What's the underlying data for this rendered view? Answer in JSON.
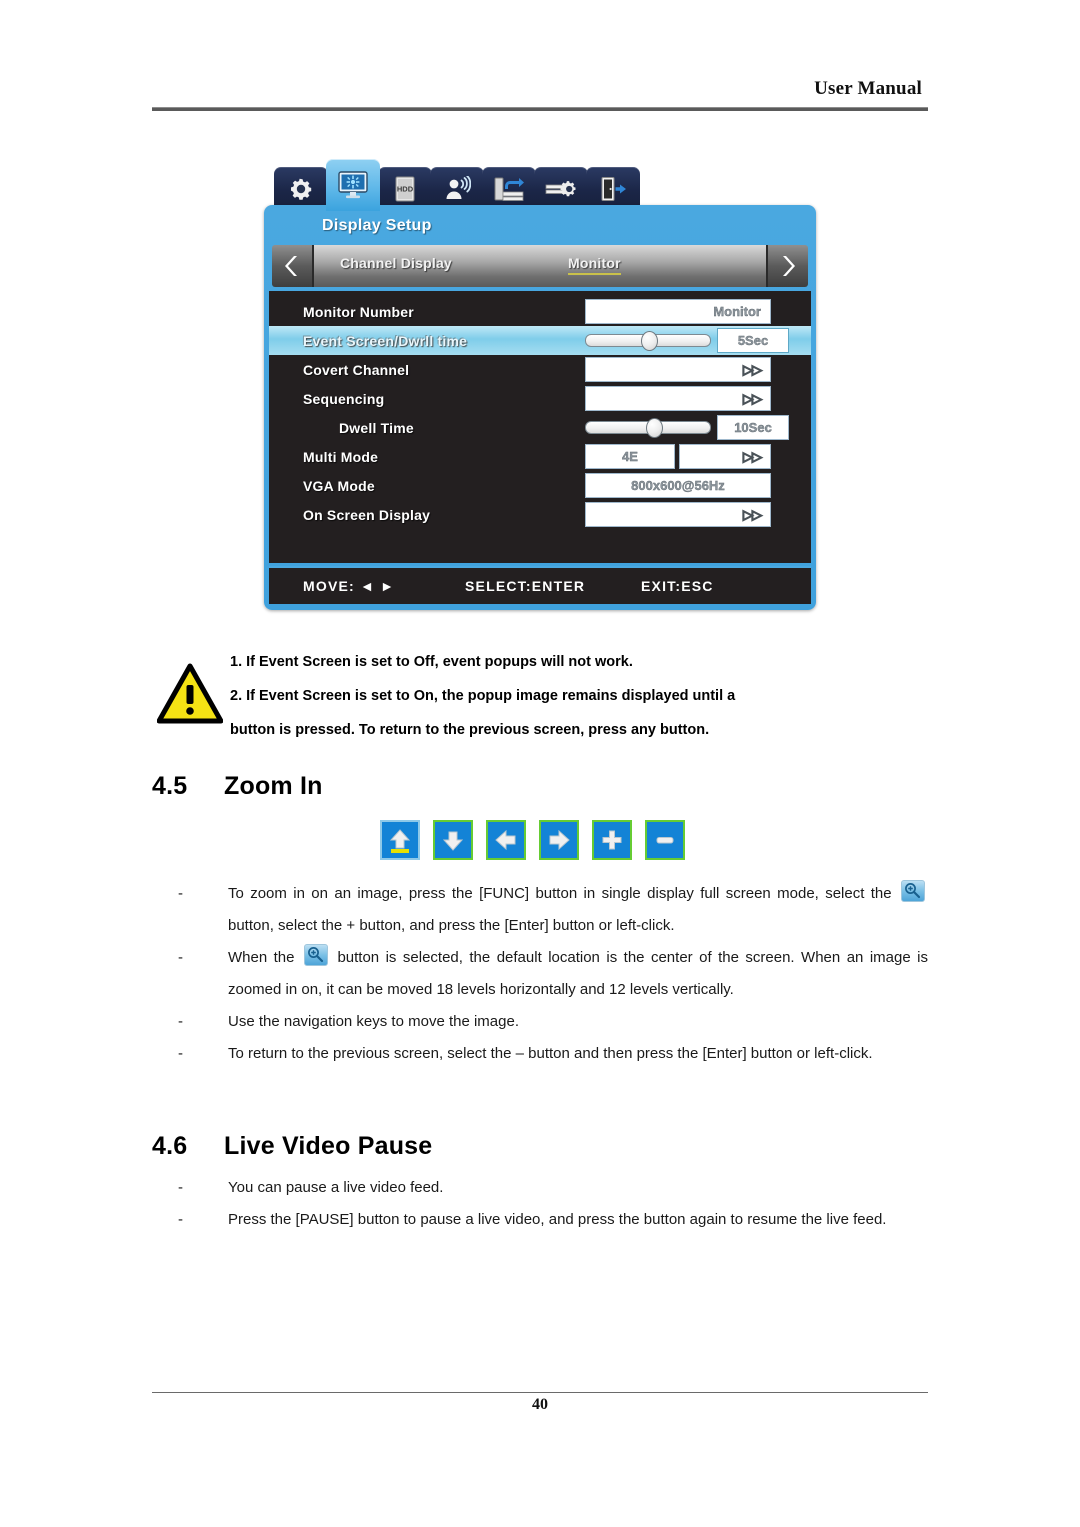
{
  "header": {
    "title": "User Manual"
  },
  "osd": {
    "tabs": [
      {
        "name": "system-setup-tab",
        "icon": "gear-icon",
        "selected": false
      },
      {
        "name": "display-setup-tab",
        "icon": "monitor-icon",
        "selected": true
      },
      {
        "name": "hdd-setup-tab",
        "icon": "hdd-icon",
        "selected": false
      },
      {
        "name": "user-setup-tab",
        "icon": "user-audio-icon",
        "selected": false
      },
      {
        "name": "backup-setup-tab",
        "icon": "device-import-icon",
        "selected": false
      },
      {
        "name": "device-config-tab",
        "icon": "device-gear-icon",
        "selected": false
      },
      {
        "name": "exit-tab",
        "icon": "exit-door-icon",
        "selected": false
      }
    ],
    "title": "Display Setup",
    "nav": {
      "prev_icon": "chevron-left-icon",
      "next_icon": "chevron-right-icon",
      "items": [
        {
          "label": "Channel Display",
          "active": false
        },
        {
          "label": "Monitor",
          "active": true
        }
      ]
    },
    "rows": [
      {
        "label": "Monitor Number",
        "type": "value",
        "value": "Monitor",
        "indent": false,
        "highlight": false
      },
      {
        "label": "Event Screen/Dwrll time",
        "type": "slider-value",
        "value": "5Sec",
        "indent": false,
        "highlight": true,
        "slider_pct": 44
      },
      {
        "label": "Covert Channel",
        "type": "chevron",
        "value": "▷▷",
        "indent": false,
        "highlight": false
      },
      {
        "label": "Sequencing",
        "type": "chevron",
        "value": "▷▷",
        "indent": false,
        "highlight": false
      },
      {
        "label": "Dwell Time",
        "type": "slider-value",
        "value": "10Sec",
        "indent": true,
        "highlight": false,
        "slider_pct": 48
      },
      {
        "label": "Multi Mode",
        "type": "dual",
        "value": "4E",
        "value2": "▷▷",
        "indent": false,
        "highlight": false
      },
      {
        "label": "VGA Mode",
        "type": "value",
        "value": "800x600@56Hz",
        "indent": false,
        "highlight": false
      },
      {
        "label": "On Screen Display",
        "type": "chevron",
        "value": "▷▷",
        "indent": false,
        "highlight": false
      }
    ],
    "footer": {
      "move": "MOVE: ◄ ►",
      "select": "SELECT:ENTER",
      "exit": "EXIT:ESC"
    }
  },
  "note": {
    "icon": "warning-triangle-icon",
    "line1": "1. If Event Screen is set to Off, event popups will not work.",
    "line2": "2. If Event Screen is set to On, the popup image remains displayed until a",
    "line3": "button is pressed. To return to the previous screen, press any button."
  },
  "sections": {
    "zoom_in": {
      "number": "4.5",
      "title": "Zoom In",
      "buttons": [
        {
          "name": "zoom-up-button",
          "icon": "arrow-up-icon",
          "selected": true
        },
        {
          "name": "zoom-down-button",
          "icon": "arrow-down-icon",
          "selected": false
        },
        {
          "name": "zoom-left-button",
          "icon": "arrow-left-icon",
          "selected": false
        },
        {
          "name": "zoom-right-button",
          "icon": "arrow-right-icon",
          "selected": false
        },
        {
          "name": "zoom-in-button",
          "icon": "plus-icon",
          "selected": false
        },
        {
          "name": "zoom-out-button",
          "icon": "minus-icon",
          "selected": false
        }
      ],
      "bullets": [
        {
          "dash": "-",
          "part1": "To zoom in on an image, press the [FUNC] button in single display full screen mode, select the",
          "icon": "magnifier-plus-icon",
          "part2": "button, select the + button, and press the [Enter] button or left-click."
        },
        {
          "dash": "-",
          "part1": "When the",
          "icon": "magnifier-plus-icon",
          "part2": "button is selected, the default location is the center of the screen. When an image is zoomed in on, it can be moved 18 levels horizontally and 12 levels vertically."
        },
        {
          "dash": "-",
          "text": "Use the navigation keys to move the image."
        },
        {
          "dash": "-",
          "text": "To return to the previous screen, select the – button and then press the [Enter] button or left-click."
        }
      ]
    },
    "live_video_pause": {
      "number": "4.6",
      "title": "Live Video Pause",
      "bullets": [
        {
          "dash": "-",
          "text": "You can pause a live video feed."
        },
        {
          "dash": "-",
          "text": "Press the [PAUSE] button to pause a live video, and press the button again to resume the live feed."
        }
      ]
    }
  },
  "footer": {
    "page_number": "40"
  },
  "colors": {
    "osd_panel_blue": "#4aa8e0",
    "osd_list_black": "#231f20",
    "highlight_cyan": "#7fcdea",
    "active_tab_underline": "#c9c14a",
    "button_blue": "#1383d6",
    "button_border_green": "#66cc33",
    "warning_yellow": "#f5e214"
  }
}
